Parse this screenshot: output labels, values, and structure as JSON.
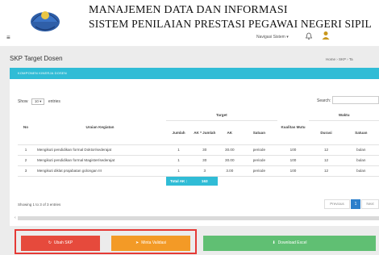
{
  "header": {
    "title_line1": "MANAJEMEN DATA DAN INFORMASI",
    "title_line2": "SISTEM PENILAIAN PRESTASI PEGAWAI NEGERI SIPIL",
    "nav_select": "Navigasi Sistem",
    "menu_icon": "hamburger-icon",
    "bell_icon": "bell-icon",
    "user_icon": "user-icon"
  },
  "page": {
    "title": "SKP Target Dosen",
    "breadcrumb": "Home › SKP › Ta",
    "box_header": "KOMPONEN KINERJA DOSEN"
  },
  "controls": {
    "show_prefix": "Show",
    "show_value": "10",
    "show_suffix": "entries",
    "search_label": "Search:",
    "search_value": ""
  },
  "table": {
    "headers": {
      "no": "No",
      "uraian": "Uraian Kegiatan",
      "target": "Target",
      "jumlah": "Jumlah",
      "ak_jumlah": "AK * Jumlah",
      "ak": "AK",
      "satuan": "Satuan",
      "kualitas": "Kualitas Mutu",
      "waktu": "Waktu",
      "durasi": "Durasi",
      "waktu_satuan": "Satuan"
    },
    "rows": [
      {
        "no": "1",
        "uraian": "Mengikuti pendidikan formal Doktor/sederajat",
        "jumlah": "1",
        "ak_jumlah": "30",
        "ak": "30.00",
        "satuan": "periode",
        "kualitas": "100",
        "durasi": "12",
        "waktu_satuan": "bulan"
      },
      {
        "no": "2",
        "uraian": "Mengikuti pendidikan formal Magister/sederajat",
        "jumlah": "1",
        "ak_jumlah": "30",
        "ak": "30.00",
        "satuan": "periode",
        "kualitas": "100",
        "durasi": "12",
        "waktu_satuan": "bulan"
      },
      {
        "no": "3",
        "uraian": "Mengikuti diklat prajabatan golongan III",
        "jumlah": "1",
        "ak_jumlah": "3",
        "ak": "3.00",
        "satuan": "periode",
        "kualitas": "100",
        "durasi": "12",
        "waktu_satuan": "bulan"
      }
    ],
    "total_label": "Total AK :",
    "total_value": "163"
  },
  "pagination": {
    "showing": "Showing 1 to 3 of 3 entries",
    "prev": "Previous",
    "page": "1",
    "next": "Next"
  },
  "buttons": {
    "ubah": "Ubah SKP",
    "minta": "Minta Validasi",
    "download": "Download Excel"
  },
  "colors": {
    "accent": "#30bcd6",
    "danger": "#e64a3c",
    "warning": "#f39a26",
    "success": "#60bf73",
    "highlight_frame": "#e53935"
  }
}
